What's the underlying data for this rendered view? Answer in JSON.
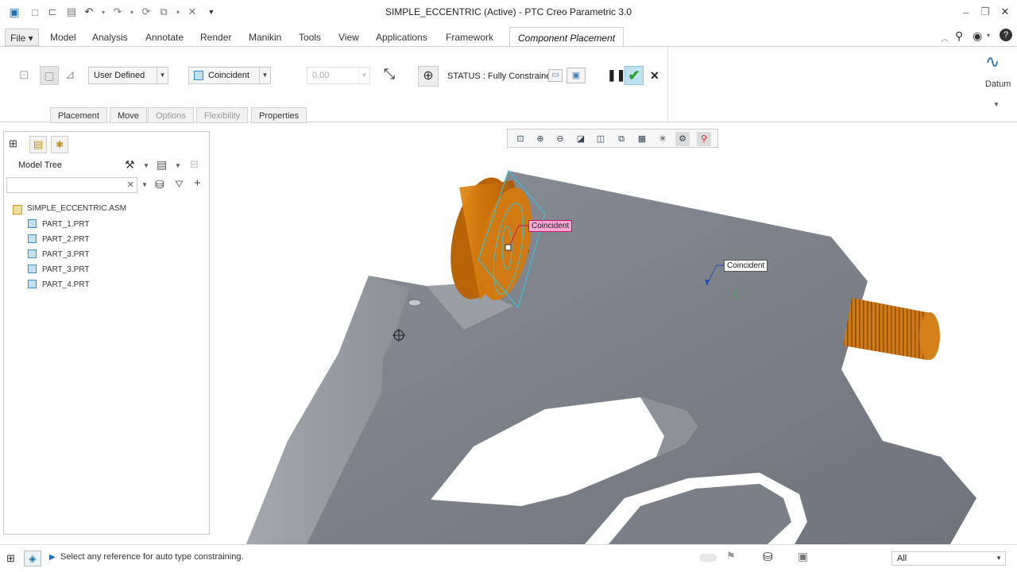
{
  "window": {
    "title": "SIMPLE_ECCENTRIC (Active) - PTC Creo Parametric 3.0"
  },
  "tabs": [
    {
      "label": "File"
    },
    {
      "label": "Model"
    },
    {
      "label": "Analysis"
    },
    {
      "label": "Annotate"
    },
    {
      "label": "Render"
    },
    {
      "label": "Manikin"
    },
    {
      "label": "Tools"
    },
    {
      "label": "View"
    },
    {
      "label": "Applications"
    },
    {
      "label": "Framework"
    },
    {
      "label": "Component Placement"
    }
  ],
  "ribbon": {
    "constraint_set": "User Defined",
    "constraint_type": "Coincident",
    "offset_value": "0.00",
    "status_text": "STATUS : Fully Constrained",
    "datum_label": "Datum",
    "subtabs": [
      "Placement",
      "Move",
      "Options",
      "Flexibility",
      "Properties"
    ]
  },
  "model_tree": {
    "title": "Model Tree",
    "search_value": "",
    "root": "SIMPLE_ECCENTRIC.ASM",
    "parts": [
      "PART_1.PRT",
      "PART_2.PRT",
      "PART_3.PRT",
      "PART_3.PRT",
      "PART_4.PRT"
    ]
  },
  "viewport": {
    "constraint_labels": [
      "Coincident",
      "Coincident"
    ]
  },
  "statusbar": {
    "message": "Select any reference for auto type constraining.",
    "filter_value": "All"
  },
  "colors": {
    "accent": "#1f6fb2",
    "part_gray": "#7d818a",
    "part_orange": "#d07a10",
    "confirm_green": "#2aa02a"
  }
}
